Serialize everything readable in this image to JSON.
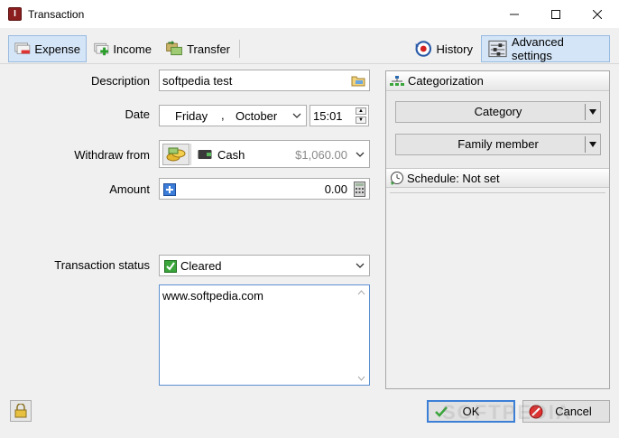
{
  "window": {
    "title": "Transaction"
  },
  "toolbar": {
    "expense": "Expense",
    "income": "Income",
    "transfer": "Transfer",
    "history": "History",
    "advanced": "Advanced settings"
  },
  "form": {
    "description_label": "Description",
    "description_value": "softpedia test",
    "date_label": "Date",
    "date_day": "Friday",
    "date_sep": ",",
    "date_month": "October",
    "time_value": "15:01",
    "withdraw_label": "Withdraw from",
    "account_name": "Cash",
    "account_balance": "$1,060.00",
    "amount_label": "Amount",
    "amount_value": "0.00",
    "status_label": "Transaction status",
    "status_value": "Cleared",
    "notes_value": "www.softpedia.com"
  },
  "panel": {
    "categorization": "Categorization",
    "category": "Category",
    "family_member": "Family member",
    "schedule": "Schedule: Not set"
  },
  "buttons": {
    "ok": "OK",
    "cancel": "Cancel"
  },
  "watermark": "SOFTPEDIA"
}
